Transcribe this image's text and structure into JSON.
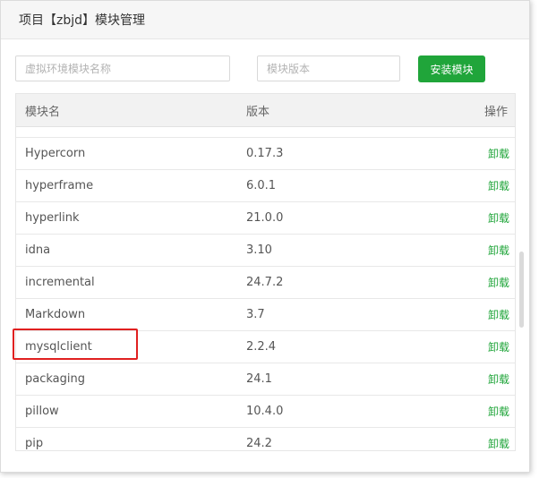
{
  "dialog": {
    "title": "项目【zbjd】模块管理"
  },
  "toolbar": {
    "search_placeholder": "虚拟环境模块名称",
    "version_placeholder": "模块版本",
    "install_label": "安装模块"
  },
  "table": {
    "headers": {
      "name": "模块名",
      "version": "版本",
      "action": "操作"
    },
    "rows": [
      {
        "name": "Hypercorn",
        "version": "0.17.3",
        "action": "卸载"
      },
      {
        "name": "hyperframe",
        "version": "6.0.1",
        "action": "卸载"
      },
      {
        "name": "hyperlink",
        "version": "21.0.0",
        "action": "卸载"
      },
      {
        "name": "idna",
        "version": "3.10",
        "action": "卸载"
      },
      {
        "name": "incremental",
        "version": "24.7.2",
        "action": "卸载"
      },
      {
        "name": "Markdown",
        "version": "3.7",
        "action": "卸载"
      },
      {
        "name": "mysqlclient",
        "version": "2.2.4",
        "action": "卸载"
      },
      {
        "name": "packaging",
        "version": "24.1",
        "action": "卸载"
      },
      {
        "name": "pillow",
        "version": "10.4.0",
        "action": "卸载"
      },
      {
        "name": "pip",
        "version": "24.2",
        "action": "卸载"
      }
    ]
  },
  "colors": {
    "accent": "#20a53a",
    "highlight": "#e02020"
  }
}
